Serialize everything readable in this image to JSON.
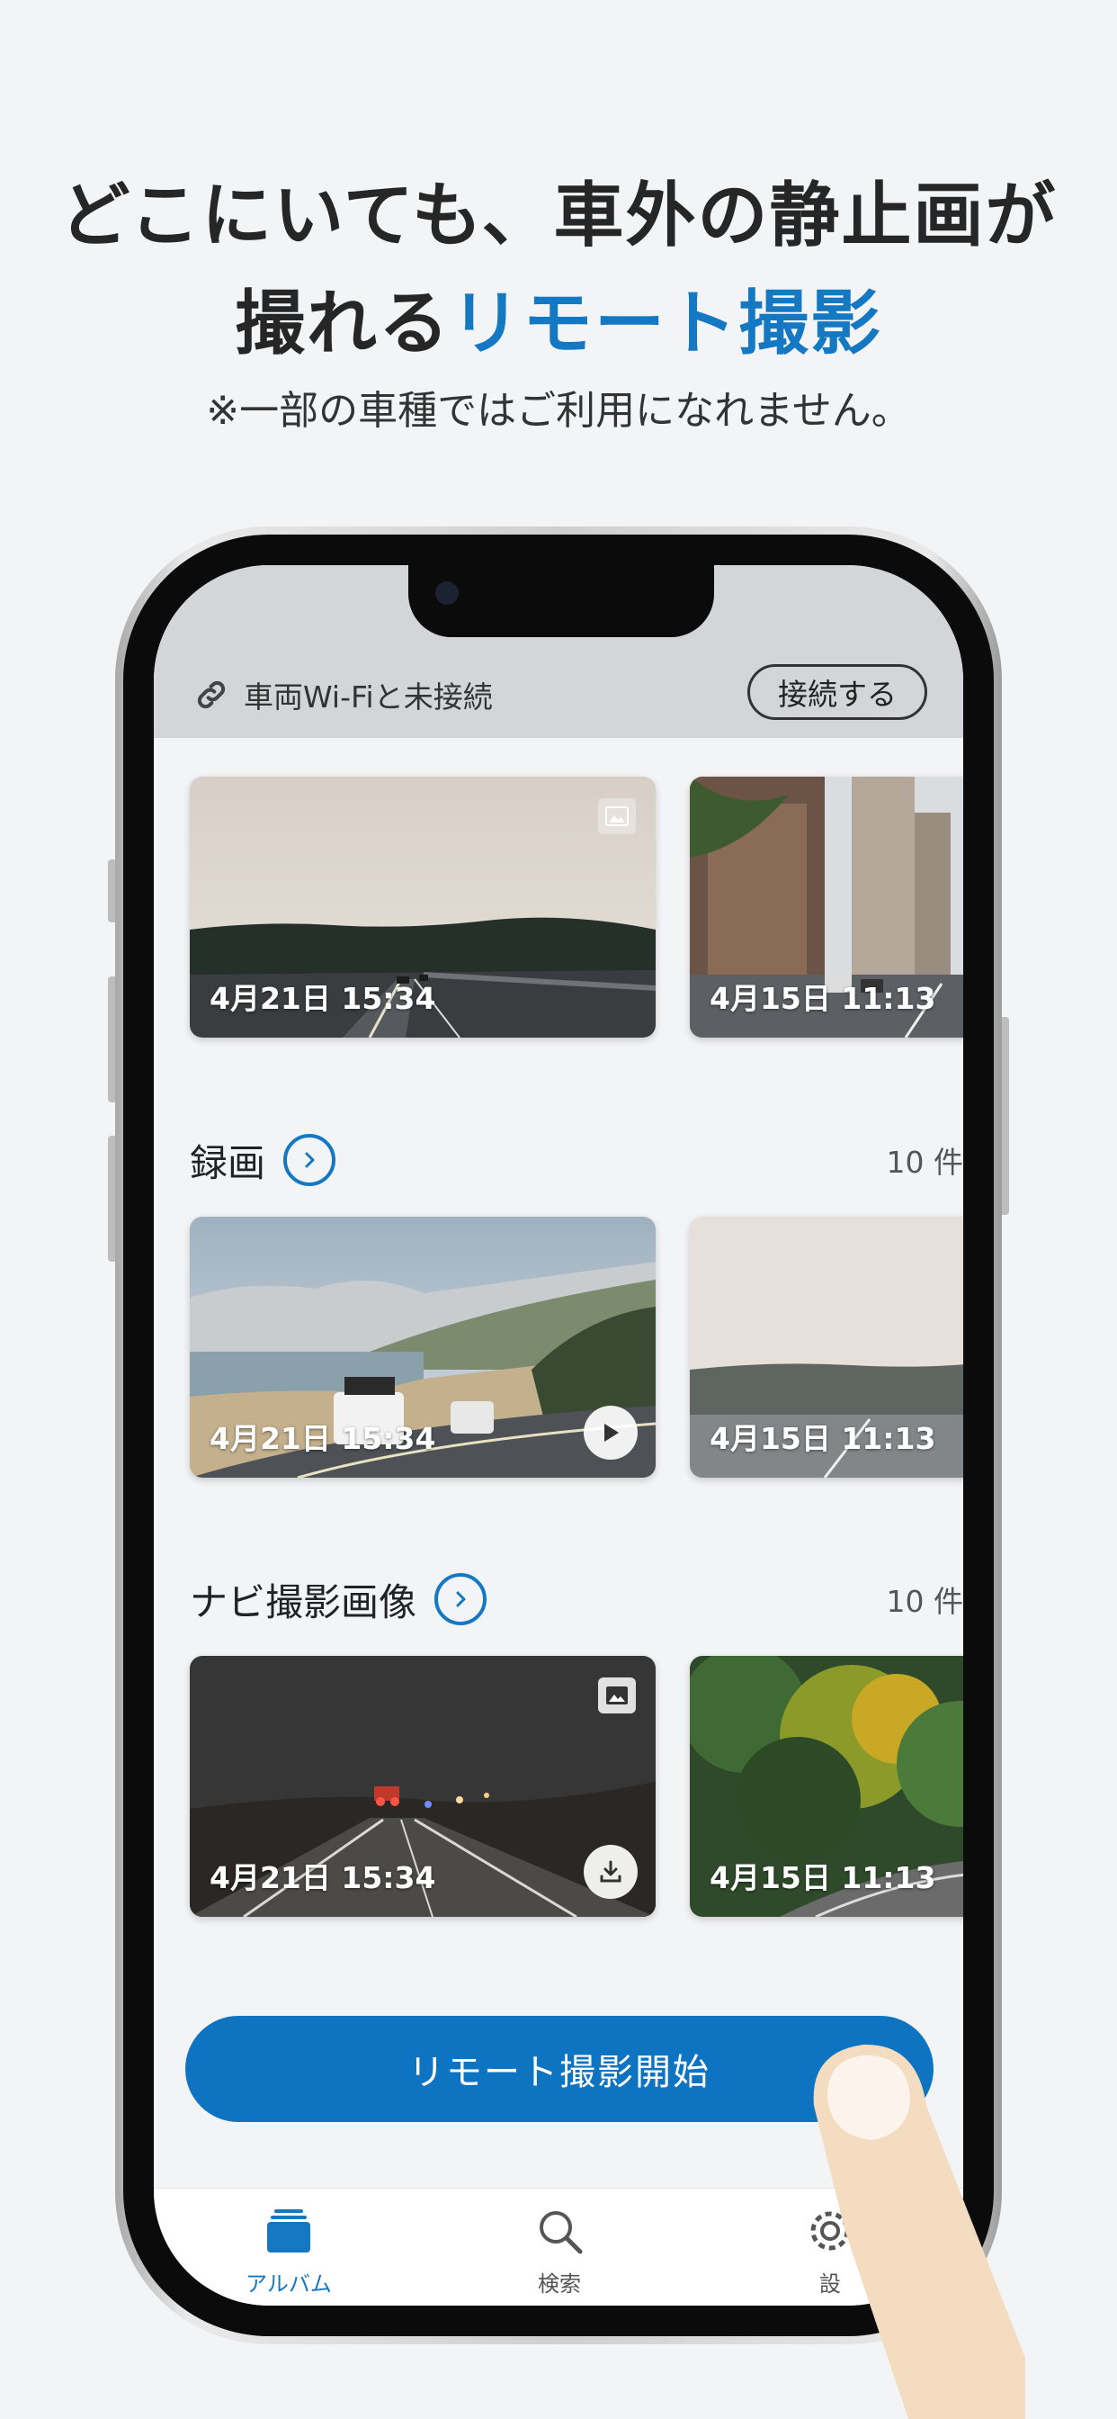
{
  "promo": {
    "headline_line1": "どこにいても、車外の静止画が",
    "headline_line2_plain": "撮れる",
    "headline_line2_accent": "リモート撮影",
    "note": "※一部の車種ではご利用になれません。"
  },
  "app": {
    "connection": {
      "status_text": "車両Wi-Fiと未接続",
      "connect_button": "接続する"
    },
    "photos_row": [
      {
        "date": "4月21日 15:34",
        "badge": "image-icon"
      },
      {
        "date": "4月15日 11:13"
      }
    ],
    "recordings": {
      "title": "録画",
      "count": "10 件",
      "items": [
        {
          "date": "4月21日 15:34",
          "action": "play-icon"
        },
        {
          "date": "4月15日 11:13"
        }
      ]
    },
    "navi_images": {
      "title": "ナビ撮影画像",
      "count": "10 件",
      "items": [
        {
          "date": "4月21日 15:34",
          "badge": "image-icon",
          "action": "download-icon"
        },
        {
          "date": "4月15日 11:13"
        }
      ]
    },
    "cta_button": "リモート撮影開始",
    "tabs": [
      {
        "label": "アルバム",
        "icon": "album-icon",
        "active": true
      },
      {
        "label": "検索",
        "icon": "search-icon",
        "active": false
      },
      {
        "label": "設",
        "icon": "gear-icon",
        "active": false
      }
    ],
    "colors": {
      "accent": "#1478c3",
      "button": "#0e74c2"
    }
  }
}
